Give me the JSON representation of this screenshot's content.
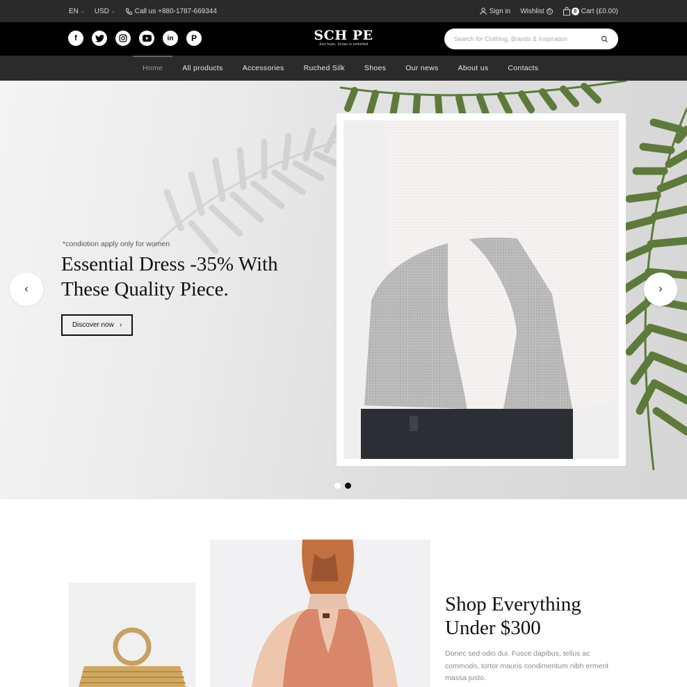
{
  "topbar": {
    "language": "EN",
    "currency": "USD",
    "phone": "Call us +880-1787-669344",
    "sign_in": "Sign in",
    "wishlist": "Wishlist",
    "wishlist_count": "0",
    "cart_count": "0",
    "cart": "Cart (£0.00)"
  },
  "header": {
    "socials": [
      "facebook-icon",
      "twitter-icon",
      "instagram-icon",
      "youtube-icon",
      "linkedin-icon",
      "pinterest-icon"
    ],
    "logo": "SCH PE",
    "tagline": "Just hope, Scope is unlimited",
    "search_placeholder": "Search for Clothing, Brands & Inspiration"
  },
  "nav": {
    "items": [
      "Home",
      "All products",
      "Accessories",
      "Ruched Silk",
      "Shoes",
      "Our news",
      "About us",
      "Contacts"
    ]
  },
  "hero": {
    "subtitle": "*condiotion apply only for women",
    "title": "Essential Dress -35% With These Quality Piece.",
    "cta": "Discover now",
    "slide_count": 2,
    "active_slide": 2
  },
  "promo": {
    "title": "Shop Everything Under $300",
    "text": "Donec sed odio dui. Fusce dapibus, tellus ac commodo, tortor mauris condimentum nibh erment massa justo."
  },
  "colors": {
    "topbar": "#2a2a2a",
    "header": "#000000",
    "nav": "#2b2b2b",
    "fern": "#5e7a3a"
  }
}
